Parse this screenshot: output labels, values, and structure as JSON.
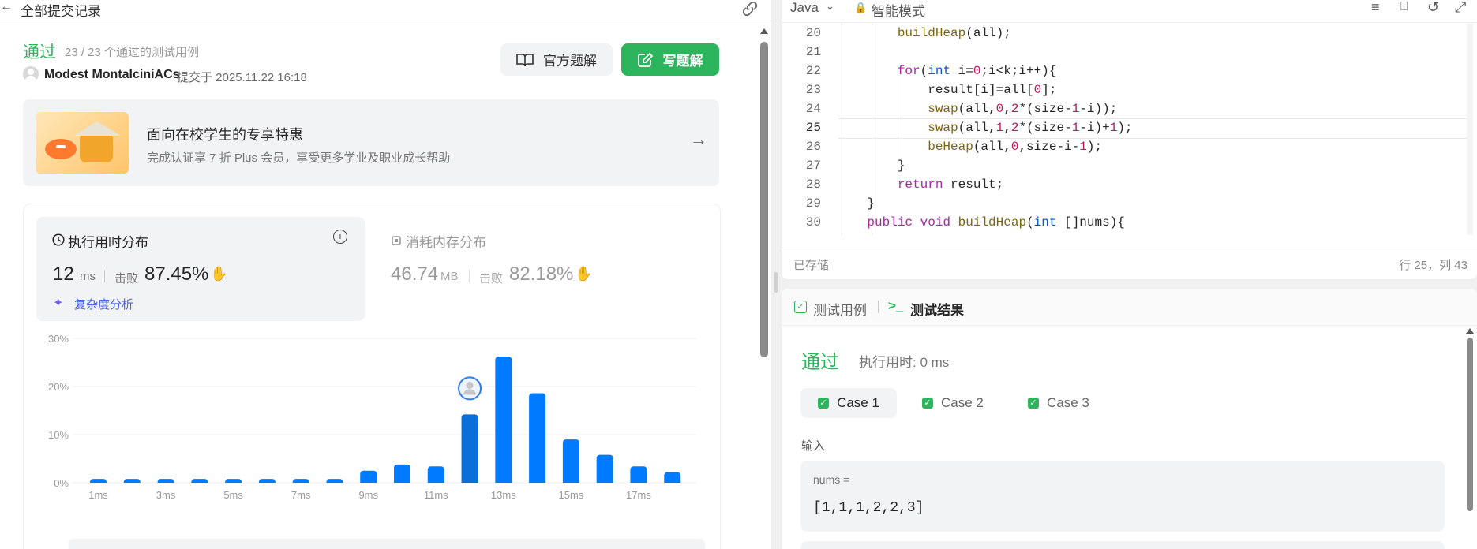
{
  "header": {
    "back_label": "全部提交记录"
  },
  "submission": {
    "status": "通过",
    "testcases": "23 / 23 个通过的测试用例",
    "author": "Modest MontalciniACs",
    "submitted_at": "提交于 2025.11.22 16:18",
    "official_solution_label": "官方题解",
    "write_solution_label": "写题解"
  },
  "promo": {
    "title": "面向在校学生的专享特惠",
    "subtitle": "完成认证享 7 折 Plus 会员，享受更多学业及职业成长帮助"
  },
  "runtime": {
    "title": "执行用时分布",
    "value": "12",
    "unit": "ms",
    "beats_label": "击败",
    "beats_value": "87.45%",
    "complexity_label": "复杂度分析"
  },
  "memory": {
    "title": "消耗内存分布",
    "value": "46.74",
    "unit": "MB",
    "beats_label": "击败",
    "beats_value": "82.18%"
  },
  "chart_data": {
    "type": "bar",
    "categories": [
      "1ms",
      "2ms",
      "3ms",
      "4ms",
      "5ms",
      "6ms",
      "7ms",
      "8ms",
      "9ms",
      "10ms",
      "11ms",
      "12ms",
      "13ms",
      "14ms",
      "15ms",
      "16ms",
      "17ms",
      "18ms"
    ],
    "x_tick_labels": [
      "1ms",
      "3ms",
      "5ms",
      "7ms",
      "9ms",
      "11ms",
      "13ms",
      "15ms",
      "17ms"
    ],
    "values": [
      0.8,
      0.8,
      0.8,
      0.8,
      0.8,
      0.8,
      0.8,
      0.8,
      2.5,
      3.8,
      3.4,
      14.2,
      26.2,
      18.6,
      9.0,
      5.8,
      3.4,
      2.2
    ],
    "highlight_category": "12ms",
    "y_tick_labels": [
      "0%",
      "10%",
      "20%",
      "30%"
    ],
    "ylim": [
      0,
      30
    ],
    "grid": true,
    "colors": {
      "bar": "#007aff",
      "highlight": "#0a6fd8"
    }
  },
  "editor": {
    "language": "Java",
    "mode": "智能模式",
    "saved_label": "已存储",
    "cursor_pos": "行 25，列 43",
    "lines": [
      {
        "n": "20",
        "code": "        buildHeap(all);"
      },
      {
        "n": "21",
        "code": ""
      },
      {
        "n": "22",
        "code": "        for(int i=0;i<k;i++){"
      },
      {
        "n": "23",
        "code": "            result[i]=all[0];"
      },
      {
        "n": "24",
        "code": "            swap(all,0,2*(size-1-i));"
      },
      {
        "n": "25",
        "code": "            swap(all,1,2*(size-1-i)+1);"
      },
      {
        "n": "26",
        "code": "            beHeap(all,0,size-i-1);"
      },
      {
        "n": "27",
        "code": "        }"
      },
      {
        "n": "28",
        "code": "        return result;"
      },
      {
        "n": "29",
        "code": "    }"
      },
      {
        "n": "30",
        "code": "    public void buildHeap(int []nums){"
      }
    ]
  },
  "results": {
    "tab_testcase": "测试用例",
    "tab_result": "测试结果",
    "status": "通过",
    "runtime": "执行用时: 0 ms",
    "cases": [
      "Case 1",
      "Case 2",
      "Case 3"
    ],
    "input_label": "输入",
    "param_name": "nums =",
    "param_value": "[1,1,1,2,2,3]"
  }
}
